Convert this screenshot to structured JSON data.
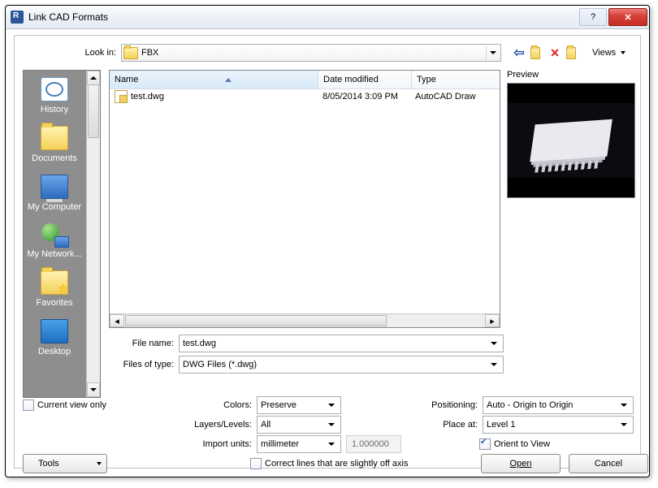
{
  "title": "Link CAD Formats",
  "lookin_label": "Look in:",
  "lookin_value": "FBX",
  "views_label": "Views",
  "places": [
    {
      "label": "History",
      "icon": "history"
    },
    {
      "label": "Documents",
      "icon": "folder"
    },
    {
      "label": "My Computer",
      "icon": "comp"
    },
    {
      "label": "My Network...",
      "icon": "net"
    },
    {
      "label": "Favorites",
      "icon": "fav"
    },
    {
      "label": "Desktop",
      "icon": "desk"
    }
  ],
  "columns": {
    "name": "Name",
    "date": "Date modified",
    "type": "Type"
  },
  "files": [
    {
      "name": "test.dwg",
      "date": "8/05/2014 3:09 PM",
      "type": "AutoCAD Draw"
    }
  ],
  "preview_label": "Preview",
  "file_name_label": "File name:",
  "file_name_value": "test.dwg",
  "file_type_label": "Files of type:",
  "file_type_value": "DWG Files  (*.dwg)",
  "current_view_only": "Current view only",
  "colors_label": "Colors:",
  "colors_value": "Preserve",
  "layers_label": "Layers/Levels:",
  "layers_value": "All",
  "units_label": "Import units:",
  "units_value": "millimeter",
  "units_scale": "1.000000",
  "correct_lines": "Correct lines that are slightly off axis",
  "positioning_label": "Positioning:",
  "positioning_value": "Auto - Origin to Origin",
  "placeat_label": "Place at:",
  "placeat_value": "Level 1",
  "orient_label": "Orient to View",
  "tools_label": "Tools",
  "open_label": "Open",
  "cancel_label": "Cancel"
}
